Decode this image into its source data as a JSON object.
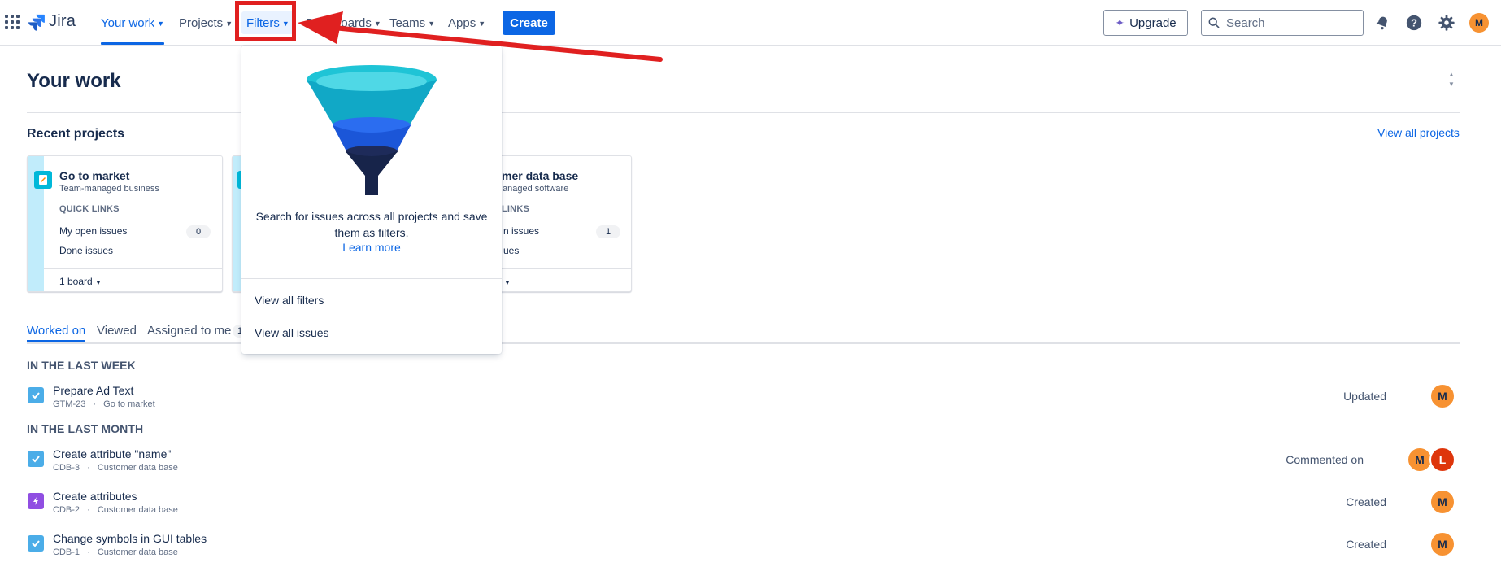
{
  "nav": {
    "logo": "Jira",
    "items": [
      {
        "label": "Your work"
      },
      {
        "label": "Projects"
      },
      {
        "label": "Filters"
      },
      {
        "label": "Dashboards"
      },
      {
        "label": "Teams"
      },
      {
        "label": "Apps"
      }
    ],
    "create_label": "Create",
    "upgrade_label": "Upgrade",
    "search_placeholder": "Search",
    "avatar_initial": "M"
  },
  "page": {
    "title": "Your work",
    "recent_projects_title": "Recent projects",
    "view_all_projects": "View all projects"
  },
  "projects": [
    {
      "name": "Go to market",
      "type": "Team-managed business",
      "quick_links_label": "QUICK LINKS",
      "links": [
        {
          "label": "My open issues",
          "count": "0"
        },
        {
          "label": "Done issues"
        }
      ],
      "board_label": "1 board"
    },
    {
      "name": "mer data base",
      "type": "anaged software",
      "quick_links_label": "LINKS",
      "links": [
        {
          "label": "n issues",
          "count": "1"
        },
        {
          "label": "ues"
        }
      ]
    }
  ],
  "tabs": [
    {
      "label": "Worked on"
    },
    {
      "label": "Viewed"
    },
    {
      "label": "Assigned to me",
      "badge": "1"
    }
  ],
  "groups": [
    {
      "heading": "IN THE LAST WEEK",
      "items": [
        {
          "title": "Prepare Ad Text",
          "key": "GTM-23",
          "project": "Go to market",
          "status": "Updated",
          "type": "task"
        }
      ]
    },
    {
      "heading": "IN THE LAST MONTH",
      "items": [
        {
          "title": "Create attribute \"name\"",
          "key": "CDB-3",
          "project": "Customer data base",
          "status": "Commented on",
          "type": "task"
        },
        {
          "title": "Create attributes",
          "key": "CDB-2",
          "project": "Customer data base",
          "status": "Created",
          "type": "epic"
        },
        {
          "title": "Change symbols in GUI tables",
          "key": "CDB-1",
          "project": "Customer data base",
          "status": "Created",
          "type": "task"
        }
      ]
    }
  ],
  "avatars": {
    "m": "M",
    "l": "L"
  },
  "meta_separator": "·",
  "dropdown": {
    "description": "Search for issues across all projects and save them as filters.",
    "learn_more": "Learn more",
    "view_all_filters": "View all filters",
    "view_all_issues": "View all issues"
  },
  "colors": {
    "brand": "#0c66e4",
    "annotation": "#e02020",
    "avatar_m": "#f79232",
    "avatar_l": "#de350b"
  }
}
